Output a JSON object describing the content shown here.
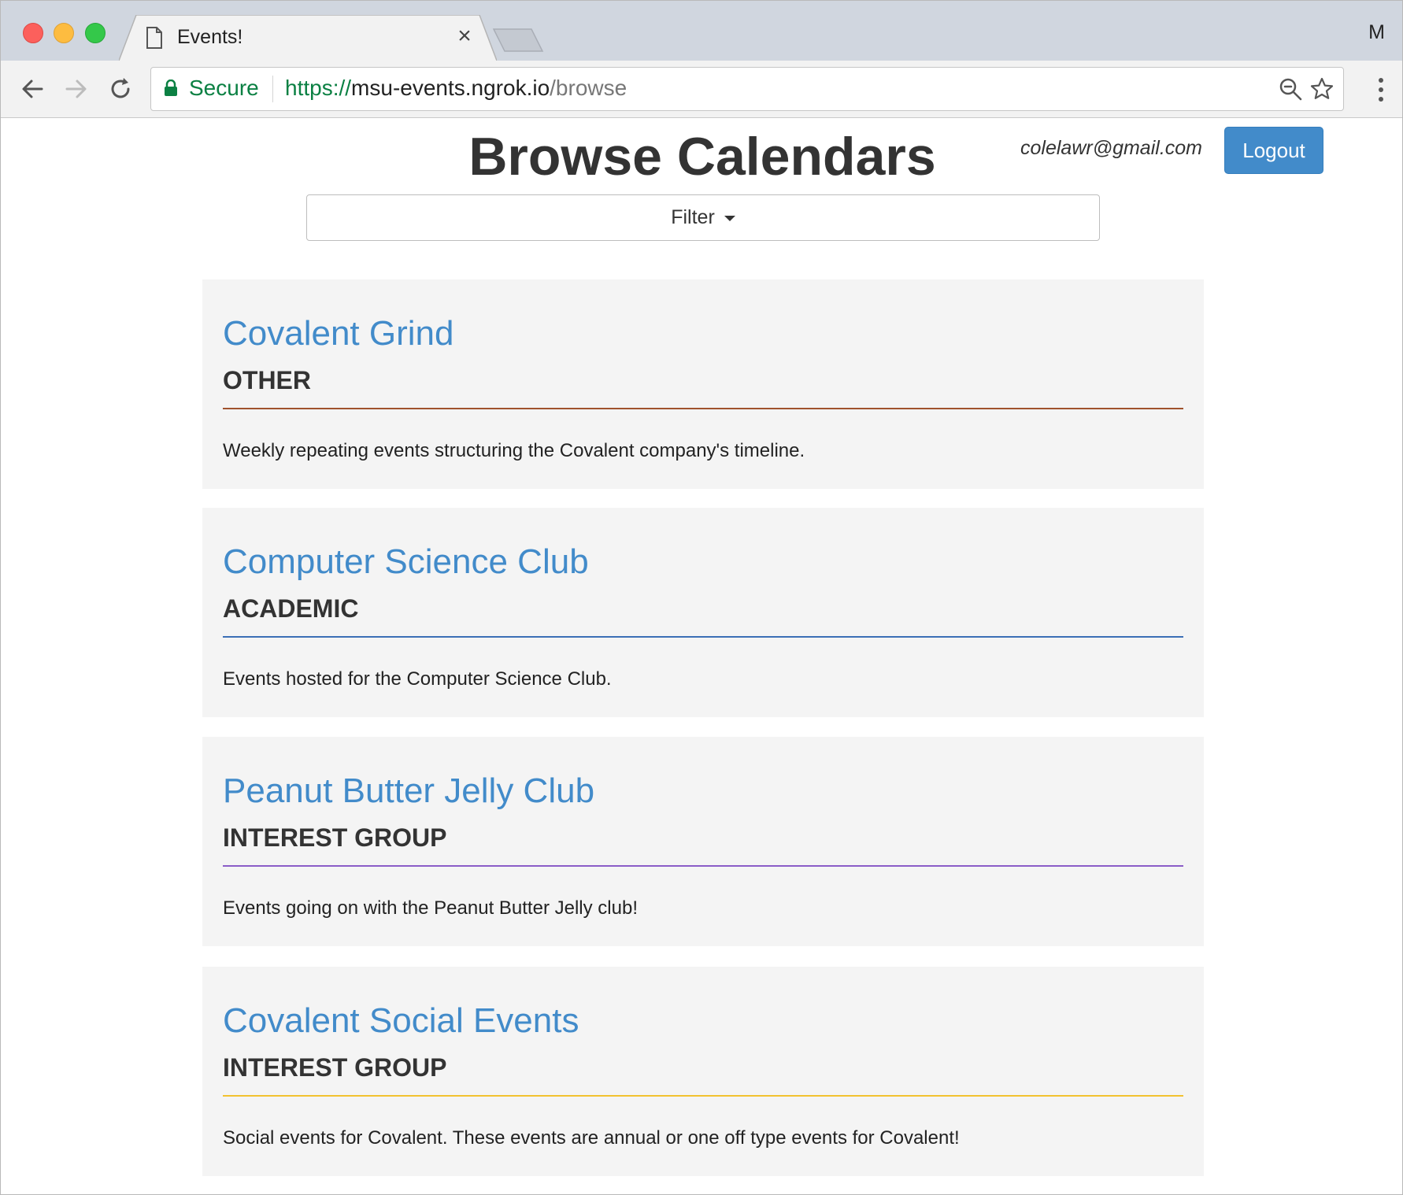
{
  "browser": {
    "tab_title": "Events!",
    "tab_close": "×",
    "profile_initial": "M",
    "secure_label": "Secure",
    "url_scheme": "https://",
    "url_host": "msu-events.ngrok.io",
    "url_path": "/browse"
  },
  "header": {
    "title": "Browse Calendars",
    "user_email": "colelawr@gmail.com",
    "logout_label": "Logout"
  },
  "filter": {
    "label": "Filter"
  },
  "calendars": [
    {
      "name": "Covalent Grind",
      "category": "OTHER",
      "rule_color": "#a0522d",
      "description": "Weekly repeating events structuring the Covalent company's timeline."
    },
    {
      "name": "Computer Science Club",
      "category": "ACADEMIC",
      "rule_color": "#3b6fb6",
      "description": "Events hosted for the Computer Science Club."
    },
    {
      "name": "Peanut Butter Jelly Club",
      "category": "INTEREST GROUP",
      "rule_color": "#8a5cc7",
      "description": "Events going on with the Peanut Butter Jelly club!"
    },
    {
      "name": "Covalent Social Events",
      "category": "INTEREST GROUP",
      "rule_color": "#f2c230",
      "description": "Social events for Covalent. These events are annual or one off type events for Covalent!"
    }
  ],
  "colors": {
    "accent": "#428bca",
    "secure_green": "#0b8043"
  },
  "icons": [
    "page-icon",
    "close-icon",
    "back-icon",
    "forward-icon",
    "reload-icon",
    "lock-icon",
    "zoom-icon",
    "star-icon",
    "menu-icon",
    "caret-down-icon"
  ]
}
